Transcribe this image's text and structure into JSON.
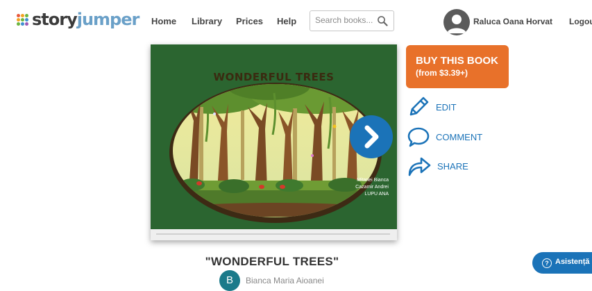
{
  "header": {
    "logo": {
      "part1": "story",
      "part2": "jumper"
    },
    "nav": [
      {
        "label": "Home"
      },
      {
        "label": "Library"
      },
      {
        "label": "Prices"
      },
      {
        "label": "Help"
      }
    ],
    "search": {
      "placeholder": "Search books...",
      "value": ""
    },
    "user": {
      "name": "Raluca Oana Horvat"
    },
    "logout_label": "Logout"
  },
  "book": {
    "cover_title": "WONDERFUL TREES",
    "cover_authors": [
      "Mitariei Bianca",
      "Cazamir Andrei",
      "LUPU ANA"
    ]
  },
  "actions": {
    "buy_label": "BUY THIS BOOK",
    "buy_price": "(from $3.39+)",
    "edit_label": "EDIT",
    "comment_label": "COMMENT",
    "share_label": "SHARE"
  },
  "footer": {
    "book_heading": "\"WONDERFUL TREES\"",
    "author_initial": "B",
    "author_name": "Bianca Maria Aioanei",
    "help_label": "Asistență"
  },
  "colors": {
    "accent_blue": "#1b73b8",
    "buy_orange": "#e8712a",
    "cover_green": "#2f6a33"
  },
  "icons": {
    "search": "search-icon",
    "next": "chevron-right-icon",
    "edit": "pencil-icon",
    "comment": "speech-bubble-icon",
    "share": "share-arrow-icon",
    "help": "question-icon"
  }
}
